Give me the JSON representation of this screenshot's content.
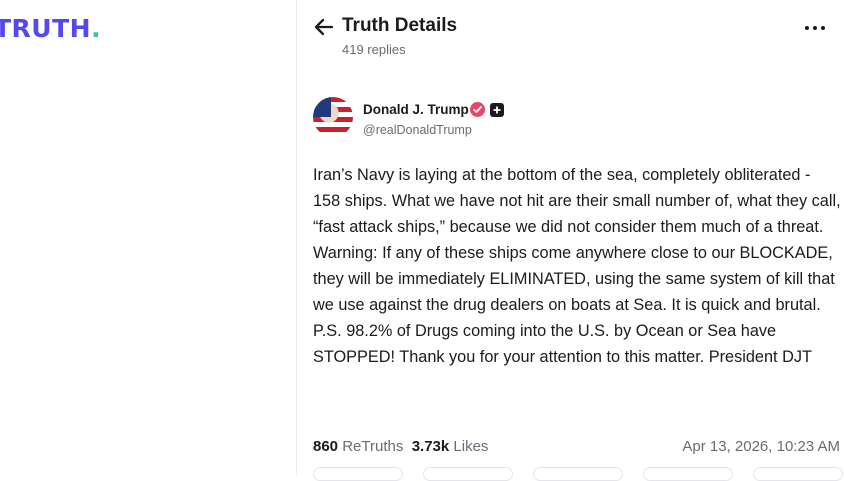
{
  "logo": {
    "text": "TRUTH",
    "dot": "."
  },
  "header": {
    "title": "Truth Details",
    "replies": "419 replies"
  },
  "post": {
    "author": "Donald J. Trump",
    "handle": "@realDonaldTrump",
    "body": "Iran’s Navy is laying at the bottom of the sea, completely obliterated - 158 ships. What we have not hit are their small number of, what they call, “fast attack ships,” because we did not consider them much of a threat. Warning: If any of these ships come anywhere close to our BLOCKADE, they will be immediately ELIMINATED, using the same system of kill that we use against the drug dealers on boats at Sea. It is quick and brutal. P.S. 98.2% of Drugs coming into the U.S. by Ocean or Sea have STOPPED! Thank you for your attention to this matter. President DJT",
    "retruths_count": "860",
    "retruths_label": "ReTruths",
    "likes_count": "3.73k",
    "likes_label": "Likes",
    "timestamp": "Apr 13, 2026, 10:23 AM"
  },
  "colors": {
    "brand": "#5448ee",
    "accent": "#35c2a5",
    "verified": "#e8446e"
  },
  "icons": [
    "back-arrow-icon",
    "more-icon",
    "verified-icon",
    "badge-icon"
  ]
}
